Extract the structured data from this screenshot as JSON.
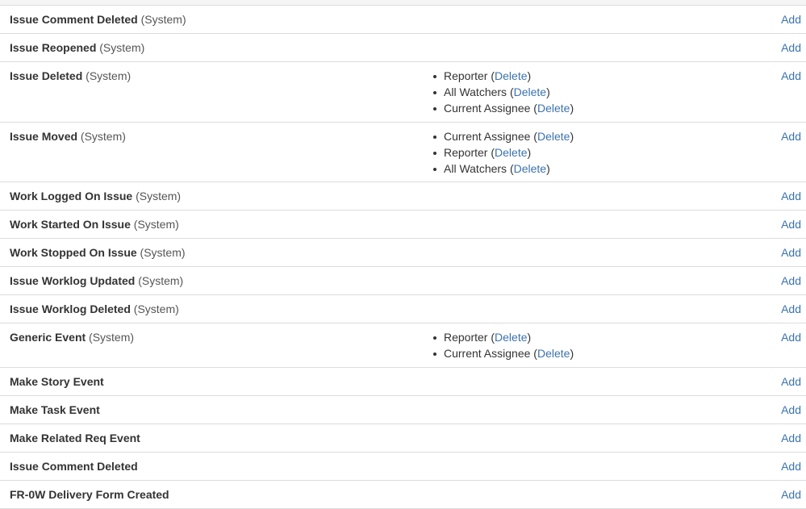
{
  "rows": [
    {
      "name": "Issue Comment Deleted",
      "scope": "(System)",
      "notifications": [],
      "action": "Add"
    },
    {
      "name": "Issue Reopened",
      "scope": "(System)",
      "notifications": [],
      "action": "Add"
    },
    {
      "name": "Issue Deleted",
      "scope": "(System)",
      "notifications": [
        {
          "who": "Reporter",
          "open": " (",
          "del": "Delete",
          "close": ")"
        },
        {
          "who": "All Watchers",
          "open": " (",
          "del": "Delete",
          "close": ")"
        },
        {
          "who": "Current Assignee",
          "open": " (",
          "del": "Delete",
          "close": ")"
        }
      ],
      "action": "Add"
    },
    {
      "name": "Issue Moved",
      "scope": "(System)",
      "notifications": [
        {
          "who": "Current Assignee",
          "open": " (",
          "del": "Delete",
          "close": ")"
        },
        {
          "who": "Reporter",
          "open": " (",
          "del": "Delete",
          "close": ")"
        },
        {
          "who": "All Watchers",
          "open": " (",
          "del": "Delete",
          "close": ")"
        }
      ],
      "action": "Add"
    },
    {
      "name": "Work Logged On Issue",
      "scope": "(System)",
      "notifications": [],
      "action": "Add"
    },
    {
      "name": "Work Started On Issue",
      "scope": "(System)",
      "notifications": [],
      "action": "Add"
    },
    {
      "name": "Work Stopped On Issue",
      "scope": "(System)",
      "notifications": [],
      "action": "Add"
    },
    {
      "name": "Issue Worklog Updated",
      "scope": "(System)",
      "notifications": [],
      "action": "Add"
    },
    {
      "name": "Issue Worklog Deleted",
      "scope": "(System)",
      "notifications": [],
      "action": "Add"
    },
    {
      "name": "Generic Event",
      "scope": "(System)",
      "notifications": [
        {
          "who": "Reporter",
          "open": " (",
          "del": "Delete",
          "close": ")"
        },
        {
          "who": "Current Assignee",
          "open": " (",
          "del": "Delete",
          "close": ")"
        }
      ],
      "action": "Add"
    },
    {
      "name": "Make Story Event",
      "scope": "",
      "notifications": [],
      "action": "Add"
    },
    {
      "name": "Make Task Event",
      "scope": "",
      "notifications": [],
      "action": "Add"
    },
    {
      "name": "Make Related Req Event",
      "scope": "",
      "notifications": [],
      "action": "Add"
    },
    {
      "name": "Issue Comment Deleted",
      "scope": "",
      "notifications": [],
      "action": "Add"
    },
    {
      "name": "FR-0W Delivery Form Created",
      "scope": "",
      "notifications": [],
      "action": "Add"
    }
  ]
}
